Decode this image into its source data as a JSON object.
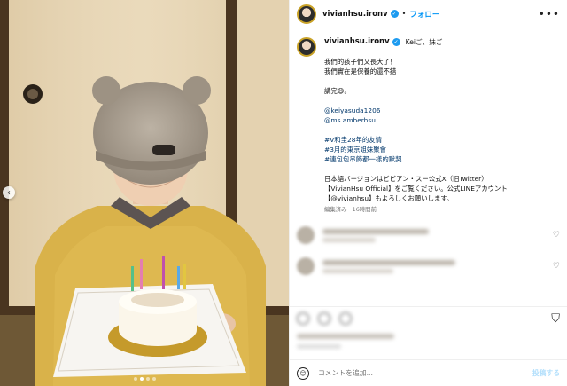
{
  "header": {
    "username": "vivianhsu.ironv",
    "separator": "•",
    "follow_label": "フォロー",
    "more_icon": "more-horizontal-icon"
  },
  "caption": {
    "username": "vivianhsu.ironv",
    "title": "Keiご、妹ご",
    "lines": [
      "我們的孩子們又長大了！",
      "我們實在是保養的還不錯",
      "",
      "講完😄。",
      "",
      "@keiyasuda1206",
      "@ms.amberhsu",
      "",
      "#V和圭28年的友情",
      "#3月的東京姐妹聚會",
      "#連包包吊飾都一樣的默契",
      "",
      "日本語バージョンはビビアン・スー公式X（旧Twitter）",
      "【VivianHsu Official】をご覧ください。公式LINEアカウント",
      "【@vivianhsu】もよろしくお願いします。"
    ],
    "link_lines": [
      5,
      6,
      8,
      9,
      10
    ],
    "meta": "編集済み · 16時間前"
  },
  "composer": {
    "placeholder": "コメントを追加...",
    "post_label": "投稿する"
  },
  "colors": {
    "accent": "#0095f6",
    "link": "#00376b",
    "verified": "#1d9bf0"
  }
}
